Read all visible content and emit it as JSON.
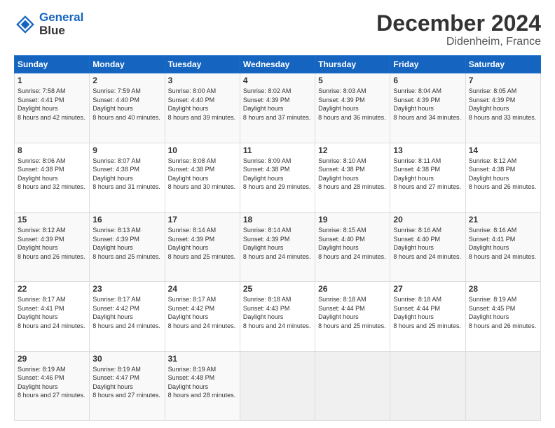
{
  "logo": {
    "line1": "General",
    "line2": "Blue"
  },
  "title": "December 2024",
  "subtitle": "Didenheim, France",
  "weekdays": [
    "Sunday",
    "Monday",
    "Tuesday",
    "Wednesday",
    "Thursday",
    "Friday",
    "Saturday"
  ],
  "weeks": [
    [
      {
        "day": "1",
        "sunrise": "7:58 AM",
        "sunset": "4:41 PM",
        "daylight": "8 hours and 42 minutes."
      },
      {
        "day": "2",
        "sunrise": "7:59 AM",
        "sunset": "4:40 PM",
        "daylight": "8 hours and 40 minutes."
      },
      {
        "day": "3",
        "sunrise": "8:00 AM",
        "sunset": "4:40 PM",
        "daylight": "8 hours and 39 minutes."
      },
      {
        "day": "4",
        "sunrise": "8:02 AM",
        "sunset": "4:39 PM",
        "daylight": "8 hours and 37 minutes."
      },
      {
        "day": "5",
        "sunrise": "8:03 AM",
        "sunset": "4:39 PM",
        "daylight": "8 hours and 36 minutes."
      },
      {
        "day": "6",
        "sunrise": "8:04 AM",
        "sunset": "4:39 PM",
        "daylight": "8 hours and 34 minutes."
      },
      {
        "day": "7",
        "sunrise": "8:05 AM",
        "sunset": "4:39 PM",
        "daylight": "8 hours and 33 minutes."
      }
    ],
    [
      {
        "day": "8",
        "sunrise": "8:06 AM",
        "sunset": "4:38 PM",
        "daylight": "8 hours and 32 minutes."
      },
      {
        "day": "9",
        "sunrise": "8:07 AM",
        "sunset": "4:38 PM",
        "daylight": "8 hours and 31 minutes."
      },
      {
        "day": "10",
        "sunrise": "8:08 AM",
        "sunset": "4:38 PM",
        "daylight": "8 hours and 30 minutes."
      },
      {
        "day": "11",
        "sunrise": "8:09 AM",
        "sunset": "4:38 PM",
        "daylight": "8 hours and 29 minutes."
      },
      {
        "day": "12",
        "sunrise": "8:10 AM",
        "sunset": "4:38 PM",
        "daylight": "8 hours and 28 minutes."
      },
      {
        "day": "13",
        "sunrise": "8:11 AM",
        "sunset": "4:38 PM",
        "daylight": "8 hours and 27 minutes."
      },
      {
        "day": "14",
        "sunrise": "8:12 AM",
        "sunset": "4:38 PM",
        "daylight": "8 hours and 26 minutes."
      }
    ],
    [
      {
        "day": "15",
        "sunrise": "8:12 AM",
        "sunset": "4:39 PM",
        "daylight": "8 hours and 26 minutes."
      },
      {
        "day": "16",
        "sunrise": "8:13 AM",
        "sunset": "4:39 PM",
        "daylight": "8 hours and 25 minutes."
      },
      {
        "day": "17",
        "sunrise": "8:14 AM",
        "sunset": "4:39 PM",
        "daylight": "8 hours and 25 minutes."
      },
      {
        "day": "18",
        "sunrise": "8:14 AM",
        "sunset": "4:39 PM",
        "daylight": "8 hours and 24 minutes."
      },
      {
        "day": "19",
        "sunrise": "8:15 AM",
        "sunset": "4:40 PM",
        "daylight": "8 hours and 24 minutes."
      },
      {
        "day": "20",
        "sunrise": "8:16 AM",
        "sunset": "4:40 PM",
        "daylight": "8 hours and 24 minutes."
      },
      {
        "day": "21",
        "sunrise": "8:16 AM",
        "sunset": "4:41 PM",
        "daylight": "8 hours and 24 minutes."
      }
    ],
    [
      {
        "day": "22",
        "sunrise": "8:17 AM",
        "sunset": "4:41 PM",
        "daylight": "8 hours and 24 minutes."
      },
      {
        "day": "23",
        "sunrise": "8:17 AM",
        "sunset": "4:42 PM",
        "daylight": "8 hours and 24 minutes."
      },
      {
        "day": "24",
        "sunrise": "8:17 AM",
        "sunset": "4:42 PM",
        "daylight": "8 hours and 24 minutes."
      },
      {
        "day": "25",
        "sunrise": "8:18 AM",
        "sunset": "4:43 PM",
        "daylight": "8 hours and 24 minutes."
      },
      {
        "day": "26",
        "sunrise": "8:18 AM",
        "sunset": "4:44 PM",
        "daylight": "8 hours and 25 minutes."
      },
      {
        "day": "27",
        "sunrise": "8:18 AM",
        "sunset": "4:44 PM",
        "daylight": "8 hours and 25 minutes."
      },
      {
        "day": "28",
        "sunrise": "8:19 AM",
        "sunset": "4:45 PM",
        "daylight": "8 hours and 26 minutes."
      }
    ],
    [
      {
        "day": "29",
        "sunrise": "8:19 AM",
        "sunset": "4:46 PM",
        "daylight": "8 hours and 27 minutes."
      },
      {
        "day": "30",
        "sunrise": "8:19 AM",
        "sunset": "4:47 PM",
        "daylight": "8 hours and 27 minutes."
      },
      {
        "day": "31",
        "sunrise": "8:19 AM",
        "sunset": "4:48 PM",
        "daylight": "8 hours and 28 minutes."
      },
      null,
      null,
      null,
      null
    ]
  ]
}
